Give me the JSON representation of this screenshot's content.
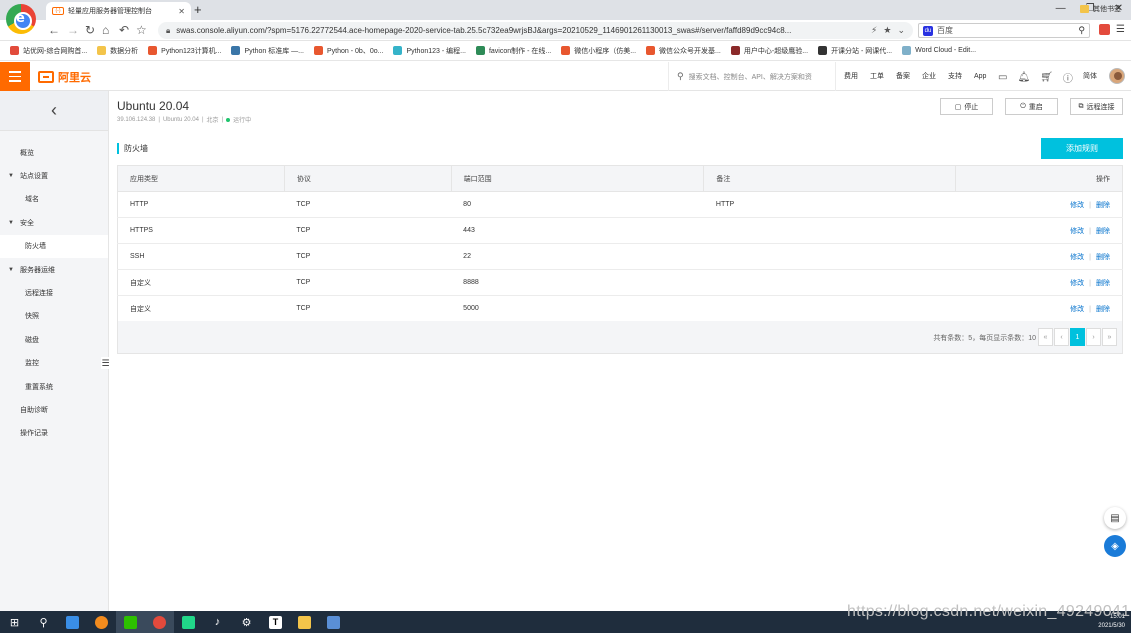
{
  "browser": {
    "tab_title": "轻量应用服务器管理控制台",
    "tab_favicon": "(-)",
    "url": "swas.console.aliyun.com/?spm=5176.22772544.ace-homepage-2020-service-tab.25.5c732ea9wrjsBJ&args=20210529_1146901261130013_swas#/server/faffd89d9cc94c8...",
    "search_engine_text": "百度",
    "bookmarks": [
      {
        "label": "站优网-综合网购首...",
        "color": "#e24b3b"
      },
      {
        "label": "数据分析",
        "color": "#f3c44a"
      },
      {
        "label": "Python123计算机...",
        "color": "#e8572f"
      },
      {
        "label": "Python 标准库 —...",
        "color": "#3a76a8"
      },
      {
        "label": "Python - 0b、0o...",
        "color": "#e8572f"
      },
      {
        "label": "Python123 - 编程...",
        "color": "#35b3c9"
      },
      {
        "label": "favicon制作 - 在线...",
        "color": "#2e8b57"
      },
      {
        "label": "微信小程序（仿美...",
        "color": "#e8572f"
      },
      {
        "label": "微信公众号开发基...",
        "color": "#e8572f"
      },
      {
        "label": "用户中心-超级鹰验...",
        "color": "#8b2a2a"
      },
      {
        "label": "开课分站 - 网课代...",
        "color": "#333333"
      },
      {
        "label": "Word Cloud - Edit...",
        "color": "#7fb0c9"
      }
    ],
    "other_bookmarks": "其他书签"
  },
  "console": {
    "logo_text": "阿里云",
    "search_placeholder": "搜索文档、控制台、API、解决方案和资",
    "top_links": [
      "费用",
      "工单",
      "备案",
      "企业",
      "支持",
      "App"
    ],
    "language": "简体"
  },
  "sidebar": {
    "back_icon": "chevron-left-icon",
    "items": [
      {
        "label": "概览",
        "type": "item"
      },
      {
        "label": "站点设置",
        "type": "group"
      },
      {
        "label": "域名",
        "type": "sub"
      },
      {
        "label": "安全",
        "type": "group"
      },
      {
        "label": "防火墙",
        "type": "sub",
        "active": true
      },
      {
        "label": "服务器运维",
        "type": "group"
      },
      {
        "label": "远程连接",
        "type": "sub"
      },
      {
        "label": "快照",
        "type": "sub"
      },
      {
        "label": "磁盘",
        "type": "sub"
      },
      {
        "label": "监控",
        "type": "sub"
      },
      {
        "label": "重置系统",
        "type": "sub"
      },
      {
        "label": "自助诊断",
        "type": "item"
      },
      {
        "label": "操作记录",
        "type": "item"
      }
    ]
  },
  "server": {
    "title": "Ubuntu 20.04",
    "ip": "39.106.124.38",
    "os": "Ubuntu 20.04",
    "region": "北京",
    "status": "运行中",
    "status_color": "#1fc46d",
    "actions": [
      {
        "label": "停止",
        "icon": "stop-icon",
        "glyph": "▢"
      },
      {
        "label": "重启",
        "icon": "restart-icon",
        "glyph": "⏻"
      },
      {
        "label": "远程连接",
        "icon": "remote-icon",
        "glyph": "⧉"
      }
    ]
  },
  "firewall": {
    "section_title": "防火墙",
    "add_button": "添加规则",
    "columns": [
      "应用类型",
      "协议",
      "端口范围",
      "备注",
      "操作"
    ],
    "rows": [
      {
        "app": "HTTP",
        "protocol": "TCP",
        "port": "80",
        "note": "HTTP"
      },
      {
        "app": "HTTPS",
        "protocol": "TCP",
        "port": "443",
        "note": ""
      },
      {
        "app": "SSH",
        "protocol": "TCP",
        "port": "22",
        "note": ""
      },
      {
        "app": "自定义",
        "protocol": "TCP",
        "port": "8888",
        "note": ""
      },
      {
        "app": "自定义",
        "protocol": "TCP",
        "port": "5000",
        "note": ""
      }
    ],
    "edit_label": "修改",
    "delete_label": "删除",
    "pagination_info": "共有条数：5，每页显示条数：10",
    "current_page": "1",
    "accent_color": "#00c1de"
  },
  "taskbar": {
    "time": "15:01",
    "date": "2021/5/30"
  },
  "watermark": "https://blog.csdn.net/weixin_49249041"
}
